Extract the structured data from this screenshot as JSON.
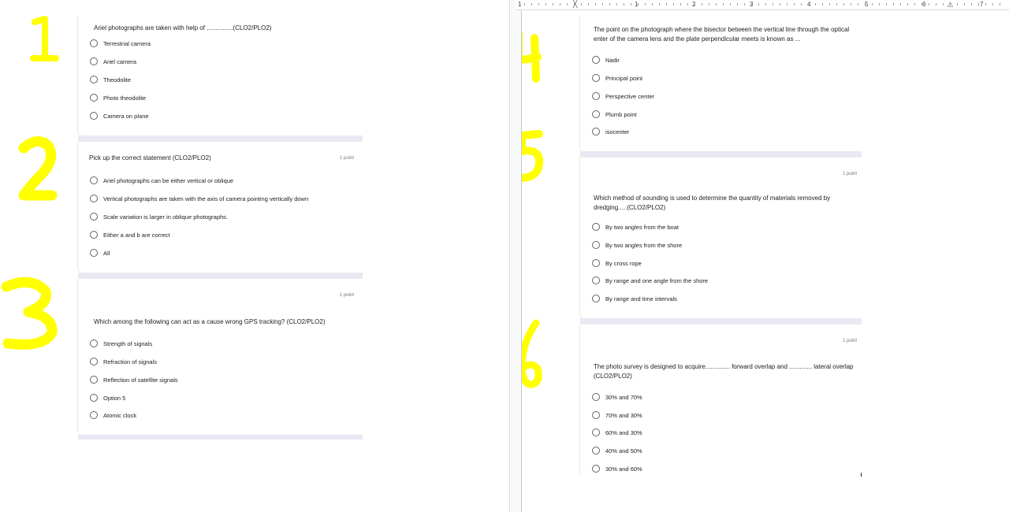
{
  "annotations": [
    "1",
    "2",
    "3",
    "4",
    "5",
    "6"
  ],
  "annotation_color": "#ffff00",
  "points_label": "1 point",
  "ruler_numbers": [
    "1",
    "1",
    "2",
    "3",
    "4",
    "5",
    "6",
    "7"
  ],
  "questions": [
    {
      "text": "Ariel photographs are taken with help of ...............(CLO2/PLO2)",
      "options": [
        "Terrestrial camera",
        "Ariel camera",
        "Theodolite",
        "Photo theodolite",
        "Camera on plane"
      ]
    },
    {
      "text": "Pick up the correct statement (CLO2/PLO2)",
      "options": [
        "Ariel photographs can be either vertical or oblique",
        "Vertical photographs are taken with the axis of camera pointing vertically down",
        "Scale variation is larger in oblique photographs.",
        "Either a and b are correct",
        "All"
      ]
    },
    {
      "text": "Which among the following can act as a cause wrong GPS tracking? (CLO2/PLO2)",
      "options": [
        "Strength of signals",
        "Refraction of signals",
        "Reflection of satellite signals",
        "Option 5",
        "Atomic clock"
      ]
    },
    {
      "text": "The point on the photograph where the bisector between the vertical line through the optical enter of the camera lens and the plate perpendicular meets is known as ...",
      "options": [
        "Nadir",
        "Principal point",
        "Perspective center",
        "Plumb point",
        "isocenter"
      ]
    },
    {
      "text": "Which method of sounding is used to determine the quantity of materials removed by dredging.....(CLO2/PLO2)",
      "options": [
        "By two angles from the boat",
        "By two angles from the shore",
        "By cross rope",
        "By range and one angle from the shore",
        "By range and time intervals"
      ]
    },
    {
      "text": "The photo survey is designed to acquire.............. forward overlap and ............. lateral overlap  (CLO2/PLO2)",
      "options": [
        "30% and 70%",
        "70% and 30%",
        "60% and 30%",
        "40% and 50%",
        "30% and 60%"
      ]
    }
  ]
}
